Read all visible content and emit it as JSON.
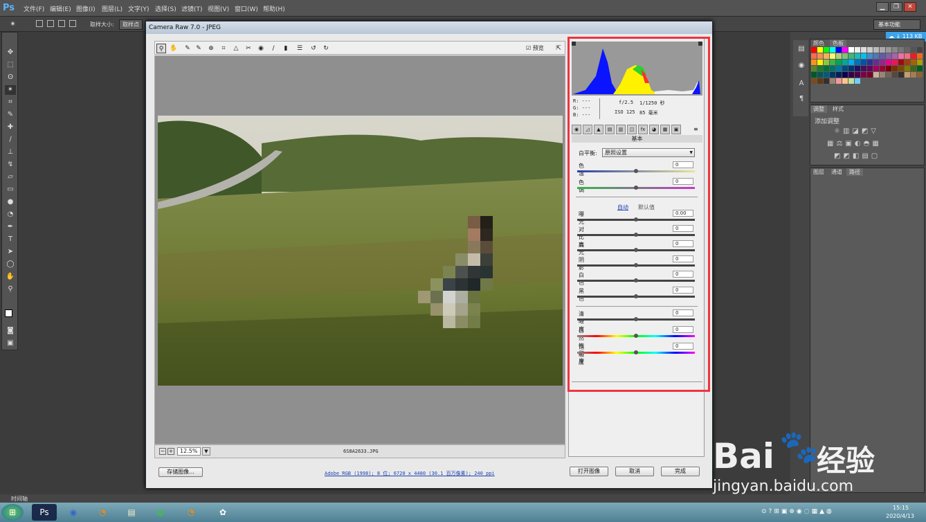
{
  "app": {
    "logo": "Ps",
    "menus": [
      "文件(F)",
      "编辑(E)",
      "图像(I)",
      "图层(L)",
      "文字(Y)",
      "选择(S)",
      "滤镜(T)",
      "视图(V)",
      "窗口(W)",
      "帮助(H)"
    ],
    "options_bar": {
      "sample_size_label": "取样大小:",
      "sample_size_value": "取样点"
    },
    "workspace": "基本功能",
    "cloud_badge": "113 KB",
    "statusbar_label": "时间轴"
  },
  "panels": {
    "swatches_tabs": [
      "颜色",
      "色板"
    ],
    "adjustments_tabs": [
      "调整",
      "样式"
    ],
    "adjustments_title": "添加调整",
    "layers_tabs": [
      "图层",
      "通道",
      "路径"
    ],
    "swatch_colors": [
      "#ff0000",
      "#ffff00",
      "#00ff00",
      "#00ffff",
      "#0000ff",
      "#ff00ff",
      "#ffffff",
      "#eeeeee",
      "#dddddd",
      "#cccccc",
      "#bbbbbb",
      "#aaaaaa",
      "#999999",
      "#888888",
      "#777777",
      "#666666",
      "#555555",
      "#444444",
      "#f26c4f",
      "#f68e56",
      "#fbaf5d",
      "#fff568",
      "#acd373",
      "#7cc576",
      "#3bb878",
      "#1abbb4",
      "#00bff3",
      "#438ccb",
      "#5574b9",
      "#605ca8",
      "#855fa8",
      "#a763a8",
      "#f06ea9",
      "#f26d7d",
      "#ed1c24",
      "#f26522",
      "#f7941d",
      "#fff200",
      "#8dc73f",
      "#39b54a",
      "#00a651",
      "#00a99d",
      "#00aeef",
      "#0072bc",
      "#0054a6",
      "#2e3192",
      "#662d91",
      "#92278f",
      "#ec008c",
      "#ed145b",
      "#9e0b0f",
      "#a0410d",
      "#a3620a",
      "#aba000",
      "#598527",
      "#1a7b30",
      "#007236",
      "#00746b",
      "#0076a3",
      "#004b80",
      "#003471",
      "#1b1464",
      "#440e62",
      "#630460",
      "#9e005d",
      "#9e0039",
      "#790000",
      "#7b2e00",
      "#7d4900",
      "#827b00",
      "#406618",
      "#005e20",
      "#005826",
      "#005952",
      "#005b7f",
      "#003663",
      "#002157",
      "#0d004c",
      "#32004b",
      "#4b0049",
      "#7b0046",
      "#7a0026",
      "#c7b299",
      "#998675",
      "#736357",
      "#534741",
      "#37302d",
      "#c69c6d",
      "#a67c52",
      "#8c6239",
      "#754c24",
      "#603913",
      "#362f2d",
      "#998675",
      "#f5989d",
      "#fdc689",
      "#c4df9b",
      "#6dcff6"
    ]
  },
  "dialog": {
    "title": "Camera Raw 7.0 - JPEG",
    "preview_label": "预览",
    "zoom": "12.5%",
    "filename": "6S8A2633.JPG",
    "exif": {
      "r": "R: ---",
      "g": "G: ---",
      "b": "B: ---",
      "aperture": "f/2.5",
      "shutter": "1/1250 秒",
      "iso": "ISO 125",
      "focal": "85 毫米"
    },
    "section_title": "基本",
    "wb_label": "白平衡:",
    "wb_value": "原照设置",
    "auto": "自动",
    "default": "默认值",
    "sliders": [
      {
        "label": "色温",
        "value": "0",
        "pos": 0.5
      },
      {
        "label": "色调",
        "value": "0",
        "pos": 0.5
      },
      {
        "label": "曝光",
        "value": "0.00",
        "pos": 0.5
      },
      {
        "label": "对比度",
        "value": "0",
        "pos": 0.5
      },
      {
        "label": "高光",
        "value": "0",
        "pos": 0.5
      },
      {
        "label": "阴影",
        "value": "0",
        "pos": 0.5
      },
      {
        "label": "白色",
        "value": "0",
        "pos": 0.5
      },
      {
        "label": "黑色",
        "value": "0",
        "pos": 0.5
      },
      {
        "label": "清晰度",
        "value": "0",
        "pos": 0.5
      },
      {
        "label": "自然饱和度",
        "value": "0",
        "pos": 0.5
      },
      {
        "label": "饱和度",
        "value": "0",
        "pos": 0.5
      }
    ],
    "save_button": "存储图像...",
    "workflow": "Adobe RGB (1998); 8 位; 6720 x 4480 (30.1 百万像素); 240 ppi",
    "open_button": "打开图像",
    "cancel_button": "取消",
    "done_button": "完成"
  },
  "taskbar": {
    "time": "15:15",
    "date": "2020/4/13"
  },
  "watermark": {
    "brand": "Bai",
    "brand2": "经验",
    "url": "jingyan.baidu.com"
  }
}
